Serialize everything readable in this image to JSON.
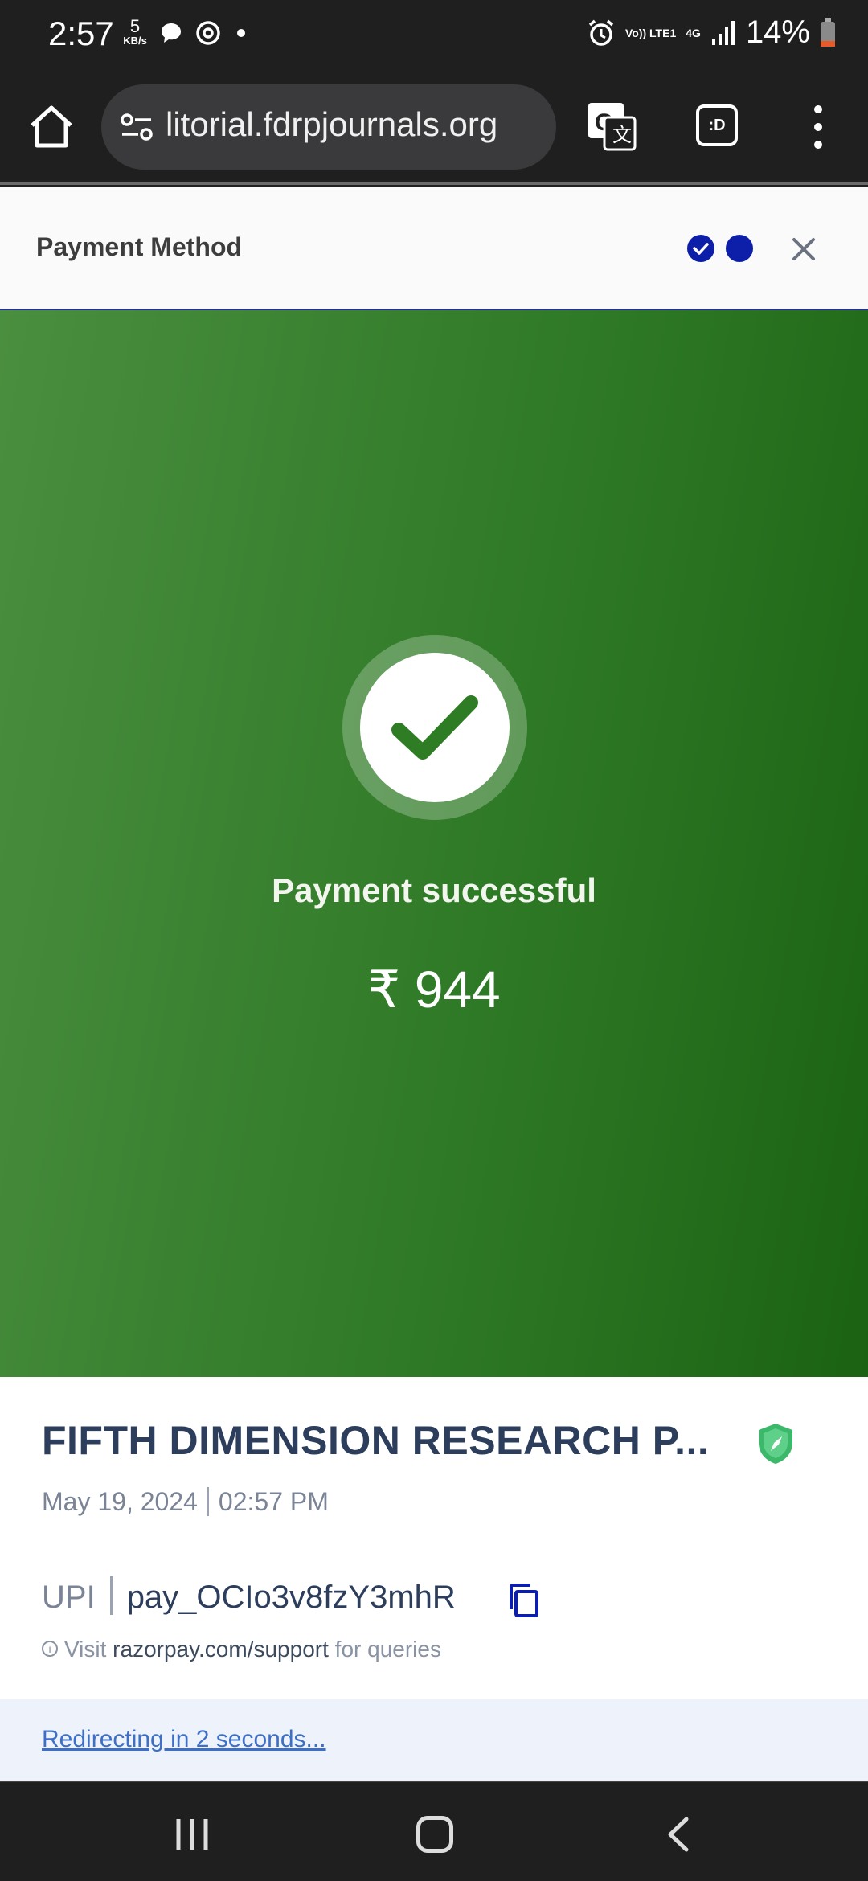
{
  "status_bar": {
    "time": "2:57",
    "speed_value": "5",
    "speed_unit": "KB/s",
    "network": "Vo)) LTE1",
    "network_type": "4G",
    "battery_percent": "14%"
  },
  "browser": {
    "url": "litorial.fdrpjournals.org",
    "tabs_label": ":D"
  },
  "header": {
    "title": "Payment Method"
  },
  "success": {
    "message": "Payment successful",
    "amount": "₹ 944",
    "accent_color": "#2e7d24"
  },
  "details": {
    "merchant": "FIFTH DIMENSION RESEARCH P...",
    "date": "May 19, 2024",
    "time": "02:57 PM",
    "method": "UPI",
    "payment_id": "pay_OCIo3v8fzY3mhR",
    "support_prefix": "Visit",
    "support_link": "razorpay.com/support",
    "support_suffix": "for queries"
  },
  "redirect": {
    "text": "Redirecting in 2 seconds..."
  }
}
